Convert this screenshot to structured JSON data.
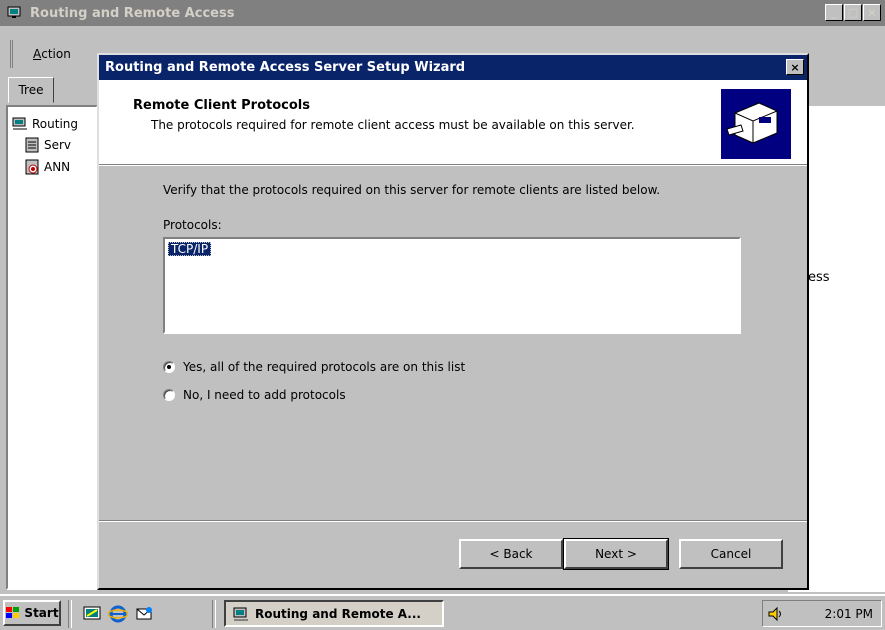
{
  "main_window": {
    "title": "Routing and Remote Access",
    "minimize_glyph": "_",
    "maximize_glyph": "□",
    "close_glyph": "×",
    "menu": {
      "action_label": "Action",
      "action_mnemonic": "A",
      "action_rest": "ction"
    },
    "tree_tab_label": "Tree",
    "tree_items": [
      {
        "label": "Routing",
        "icon": "server-monitor-icon"
      },
      {
        "label": "Serv",
        "icon": "server-status-icon"
      },
      {
        "label": "ANN",
        "icon": "server-down-icon"
      }
    ],
    "right_pane_text": "ess"
  },
  "wizard": {
    "title": "Routing and Remote Access Server Setup Wizard",
    "close_glyph": "×",
    "header_title": "Remote Client Protocols",
    "header_subtitle": "The protocols required for remote client access must be available on this server.",
    "header_icon": "network-cable-icon",
    "instruction": "Verify that the protocols required on this server for remote clients are listed below.",
    "protocols_label": "Protocols:",
    "protocols": [
      "TCP/IP"
    ],
    "selected_protocol": "TCP/IP",
    "radio_options": [
      {
        "label": "Yes, all of the required protocols are on this list",
        "checked": true
      },
      {
        "label": "No, I need to add protocols",
        "checked": false
      }
    ],
    "buttons": {
      "back": "< Back",
      "next": "Next >",
      "cancel": "Cancel"
    }
  },
  "taskbar": {
    "start_label": "Start",
    "quick_launch": [
      "desktop-icon",
      "internet-explorer-icon",
      "outlook-express-icon"
    ],
    "task_button_label": "Routing and Remote A...",
    "clock": "2:01 PM",
    "tray_icon": "volume-icon"
  },
  "colors": {
    "title_active": "#0a246a",
    "title_inactive": "#808080",
    "face": "#c0c0c0"
  }
}
